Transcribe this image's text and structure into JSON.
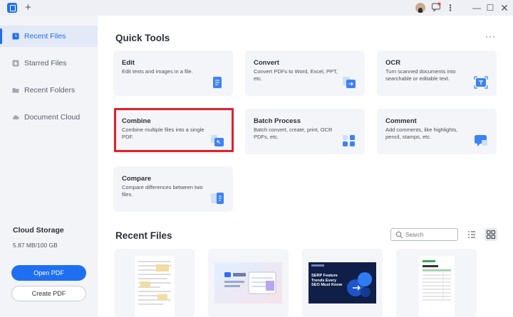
{
  "titlebar": {
    "new_tab_symbol": "+",
    "kebab_symbol": "⋮",
    "minimize_symbol": "—",
    "maximize_symbol": "☐",
    "close_symbol": "✕"
  },
  "sidebar": {
    "items": [
      {
        "label": "Recent Files",
        "icon": "clock-icon",
        "active": true
      },
      {
        "label": "Starred Files",
        "icon": "star-icon",
        "active": false
      },
      {
        "label": "Recent Folders",
        "icon": "folder-icon",
        "active": false
      },
      {
        "label": "Document Cloud",
        "icon": "cloud-icon",
        "active": false
      }
    ],
    "storage_title": "Cloud Storage",
    "storage_value": "5.87 MB/100 GB",
    "open_pdf_label": "Open PDF",
    "create_pdf_label": "Create PDF"
  },
  "quick_tools": {
    "title": "Quick Tools",
    "more_symbol": "···",
    "cards": [
      {
        "title": "Edit",
        "desc": "Edit texts and images in a file.",
        "icon": "edit-doc-icon"
      },
      {
        "title": "Convert",
        "desc": "Convert PDFs to Word, Excel, PPT, etc.",
        "icon": "convert-doc-icon"
      },
      {
        "title": "OCR",
        "desc": "Turn scanned documents into searchable or editable text.",
        "icon": "ocr-scan-icon"
      },
      {
        "title": "Combine",
        "desc": "Combine multiple files into a single PDF.",
        "icon": "combine-doc-icon"
      },
      {
        "title": "Batch Process",
        "desc": "Batch convert, create, print, OCR PDFs, etc.",
        "icon": "batch-grid-icon"
      },
      {
        "title": "Comment",
        "desc": "Add comments, like highlights, pencil, stamps, etc.",
        "icon": "comment-bubble-icon"
      },
      {
        "title": "Compare",
        "desc": "Compare differences between two files.",
        "icon": "compare-doc-icon"
      }
    ]
  },
  "recent_files": {
    "title": "Recent Files",
    "search_placeholder": "Search",
    "search_value": "",
    "files": [
      {
        "thumb": "form-document"
      },
      {
        "thumb": "product-banner"
      },
      {
        "thumb": "serp-feature-cover",
        "cover_text": "SERP Feature Trends Every SEO Must Know"
      },
      {
        "thumb": "cost-summary-doc"
      }
    ]
  },
  "colors": {
    "accent": "#1f6ff2",
    "highlight_border": "#e0202b",
    "sidebar_bg": "#f3f4f8",
    "card_bg": "#f4f5f8"
  }
}
